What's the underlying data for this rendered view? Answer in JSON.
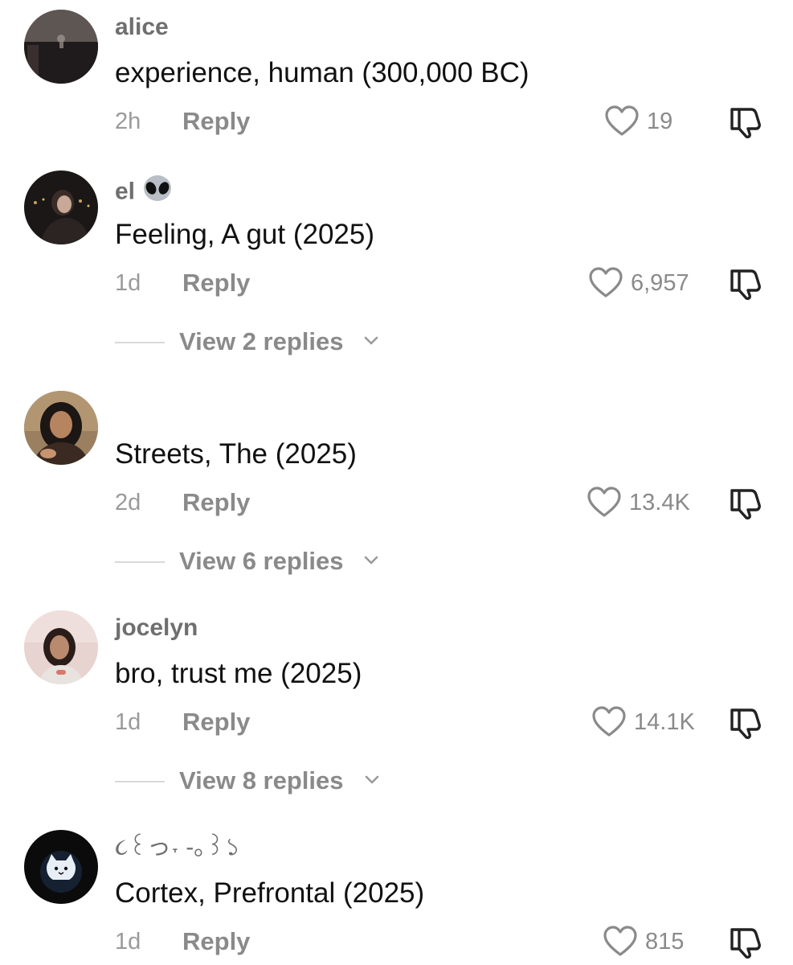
{
  "comments": [
    {
      "username": "alice",
      "text": "experience, human (300,000 BC)",
      "time": "2h",
      "reply_label": "Reply",
      "likes": "19"
    },
    {
      "username": "el",
      "username_emoji": "alien-emoji",
      "text": "Feeling, A gut (2025)",
      "time": "1d",
      "reply_label": "Reply",
      "likes": "6,957",
      "view_replies": "View 2 replies"
    },
    {
      "username": "",
      "text": "Streets, The (2025)",
      "time": "2d",
      "reply_label": "Reply",
      "likes": "13.4K",
      "view_replies": "View 6 replies"
    },
    {
      "username": "jocelyn",
      "text": "bro, trust me (2025)",
      "time": "1d",
      "reply_label": "Reply",
      "likes": "14.1K",
      "view_replies": "View 8 replies"
    },
    {
      "username": "૮꒰っ˕ -｡꒱১",
      "text": "Cortex, Prefrontal (2025)",
      "time": "1d",
      "reply_label": "Reply",
      "likes": "815"
    }
  ],
  "icons": {
    "like": "heart-outline-icon",
    "dislike": "thumbs-down-icon",
    "expand": "chevron-down-icon"
  },
  "colors": {
    "username": "#6f6f6f",
    "comment_text": "#111111",
    "secondary_text": "#8a8a8a",
    "timestamp": "#9a9a9a",
    "divider": "#d8d8d8"
  }
}
